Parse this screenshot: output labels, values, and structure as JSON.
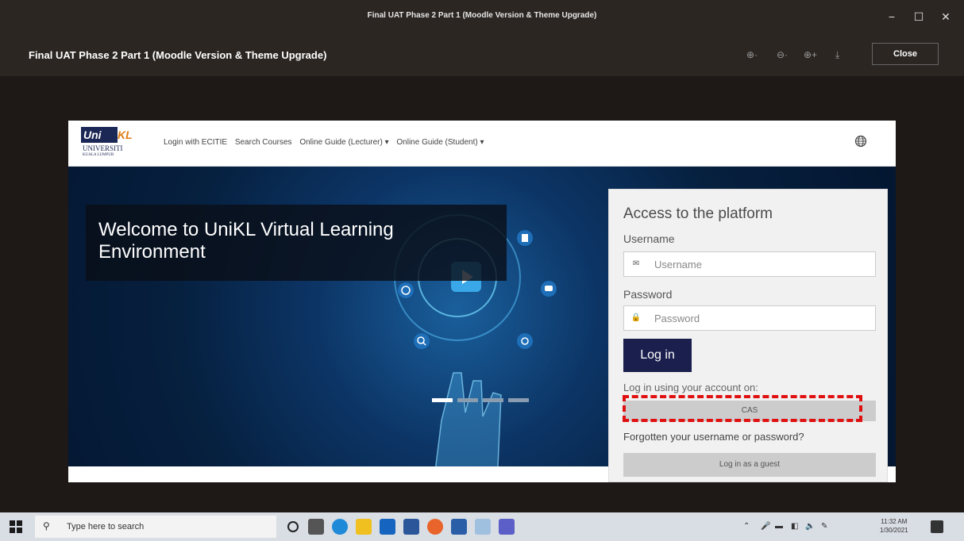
{
  "window": {
    "title": "Final UAT Phase 2 Part 1 (Moodle Version & Theme Upgrade)",
    "controls": [
      "−",
      "☐",
      "✕"
    ]
  },
  "viewer": {
    "title": "Final UAT Phase 2 Part 1 (Moodle Version & Theme Upgrade)",
    "tools": [
      "⊕·",
      "⊖·",
      "⊕+",
      "⤓"
    ],
    "close_label": "Close"
  },
  "site": {
    "logo": {
      "uni": "Uni",
      "kl": "KL",
      "universiti": "UNIVERSITI",
      "kuala_lumpur": "KUALA LUMPUR"
    },
    "nav": [
      "Login with ECITIE",
      "Search Courses",
      "Online Guide (Lecturer) ▾",
      "Online Guide (Student) ▾"
    ],
    "hero_text": "Welcome to UniKL Virtual Learning Environment",
    "slides": {
      "count": 4,
      "active": 1
    }
  },
  "login": {
    "heading": "Access to the platform",
    "username_label": "Username",
    "username_placeholder": "Username",
    "password_label": "Password",
    "password_placeholder": "Password",
    "login_button": "Log in",
    "using_text": "Log in using your account on:",
    "cas_button": "CAS",
    "forgot_text": "Forgotten your username or password?",
    "guest_button": "Log in as a guest"
  },
  "taskbar": {
    "search_placeholder": "Type here to search",
    "time": "11:32 AM",
    "date": "1/30/2021"
  }
}
